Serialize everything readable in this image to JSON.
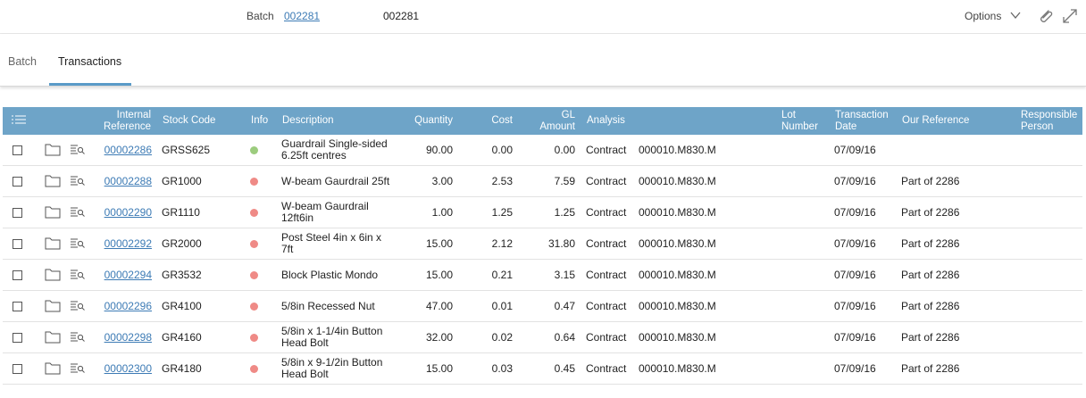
{
  "header": {
    "batch_label": "Batch",
    "batch_link": "002281",
    "batch_value": "002281",
    "options_label": "Options"
  },
  "tabs": [
    {
      "label": "Batch",
      "active": false
    },
    {
      "label": "Transactions",
      "active": true
    }
  ],
  "colors": {
    "accent": "#6ea4c8",
    "link": "#3d7bb5",
    "status_ok": "#9ccc7e",
    "status_error": "#ef8a86"
  },
  "columns": {
    "internal_reference": "Internal Reference",
    "stock_code": "Stock Code",
    "info": "Info",
    "description": "Description",
    "quantity": "Quantity",
    "cost": "Cost",
    "gl_amount": "GL Amount",
    "analysis": "Analysis",
    "lot_number": "Lot Number",
    "transaction_date": "Transaction Date",
    "our_reference": "Our Reference",
    "responsible_person": "Responsible Person"
  },
  "rows": [
    {
      "ref": "00002286",
      "stock": "GRSS625",
      "status": "green",
      "desc": "Guardrail Single-sided 6.25ft centres",
      "qty": "90.00",
      "cost": "0.00",
      "gl": "0.00",
      "analysis": "Contract",
      "analysis_code": "000010.M830.M",
      "lot": "",
      "date": "07/09/16",
      "our_ref": "",
      "person": ""
    },
    {
      "ref": "00002288",
      "stock": "GR1000",
      "status": "red",
      "desc": "W-beam Gaurdrail 25ft",
      "qty": "3.00",
      "cost": "2.53",
      "gl": "7.59",
      "analysis": "Contract",
      "analysis_code": "000010.M830.M",
      "lot": "",
      "date": "07/09/16",
      "our_ref": "Part of 2286",
      "person": ""
    },
    {
      "ref": "00002290",
      "stock": "GR1110",
      "status": "red",
      "desc": "W-beam Gaurdrail 12ft6in",
      "qty": "1.00",
      "cost": "1.25",
      "gl": "1.25",
      "analysis": "Contract",
      "analysis_code": "000010.M830.M",
      "lot": "",
      "date": "07/09/16",
      "our_ref": "Part of 2286",
      "person": ""
    },
    {
      "ref": "00002292",
      "stock": "GR2000",
      "status": "red",
      "desc": "Post Steel 4in x 6in x 7ft",
      "qty": "15.00",
      "cost": "2.12",
      "gl": "31.80",
      "analysis": "Contract",
      "analysis_code": "000010.M830.M",
      "lot": "",
      "date": "07/09/16",
      "our_ref": "Part of 2286",
      "person": ""
    },
    {
      "ref": "00002294",
      "stock": "GR3532",
      "status": "red",
      "desc": "Block Plastic Mondo",
      "qty": "15.00",
      "cost": "0.21",
      "gl": "3.15",
      "analysis": "Contract",
      "analysis_code": "000010.M830.M",
      "lot": "",
      "date": "07/09/16",
      "our_ref": "Part of 2286",
      "person": ""
    },
    {
      "ref": "00002296",
      "stock": "GR4100",
      "status": "red",
      "desc": "5/8in Recessed Nut",
      "qty": "47.00",
      "cost": "0.01",
      "gl": "0.47",
      "analysis": "Contract",
      "analysis_code": "000010.M830.M",
      "lot": "",
      "date": "07/09/16",
      "our_ref": "Part of 2286",
      "person": ""
    },
    {
      "ref": "00002298",
      "stock": "GR4160",
      "status": "red",
      "desc": "5/8in x 1-1/4in Button Head Bolt",
      "qty": "32.00",
      "cost": "0.02",
      "gl": "0.64",
      "analysis": "Contract",
      "analysis_code": "000010.M830.M",
      "lot": "",
      "date": "07/09/16",
      "our_ref": "Part of 2286",
      "person": ""
    },
    {
      "ref": "00002300",
      "stock": "GR4180",
      "status": "red",
      "desc": "5/8in x 9-1/2in Button Head Bolt",
      "qty": "15.00",
      "cost": "0.03",
      "gl": "0.45",
      "analysis": "Contract",
      "analysis_code": "000010.M830.M",
      "lot": "",
      "date": "07/09/16",
      "our_ref": "Part of 2286",
      "person": ""
    }
  ]
}
